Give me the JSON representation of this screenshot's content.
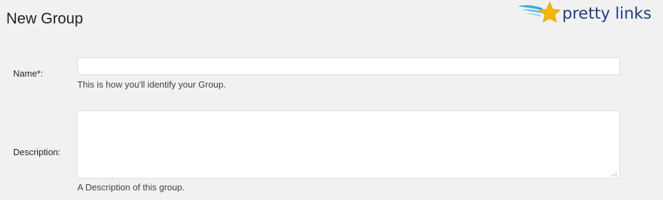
{
  "header": {
    "title": "New Group",
    "logo": {
      "text": "pretty links",
      "icon": "star-with-wings-icon",
      "colors": {
        "star": "#f7b500",
        "wings": "#3fa9e0",
        "text": "#1d3f8c"
      }
    }
  },
  "form": {
    "name": {
      "label": "Name*:",
      "value": "",
      "placeholder": "",
      "hint": "This is how you'll identify your Group."
    },
    "description": {
      "label": "Description:",
      "value": "",
      "placeholder": "",
      "hint": "A Description of this group."
    }
  }
}
